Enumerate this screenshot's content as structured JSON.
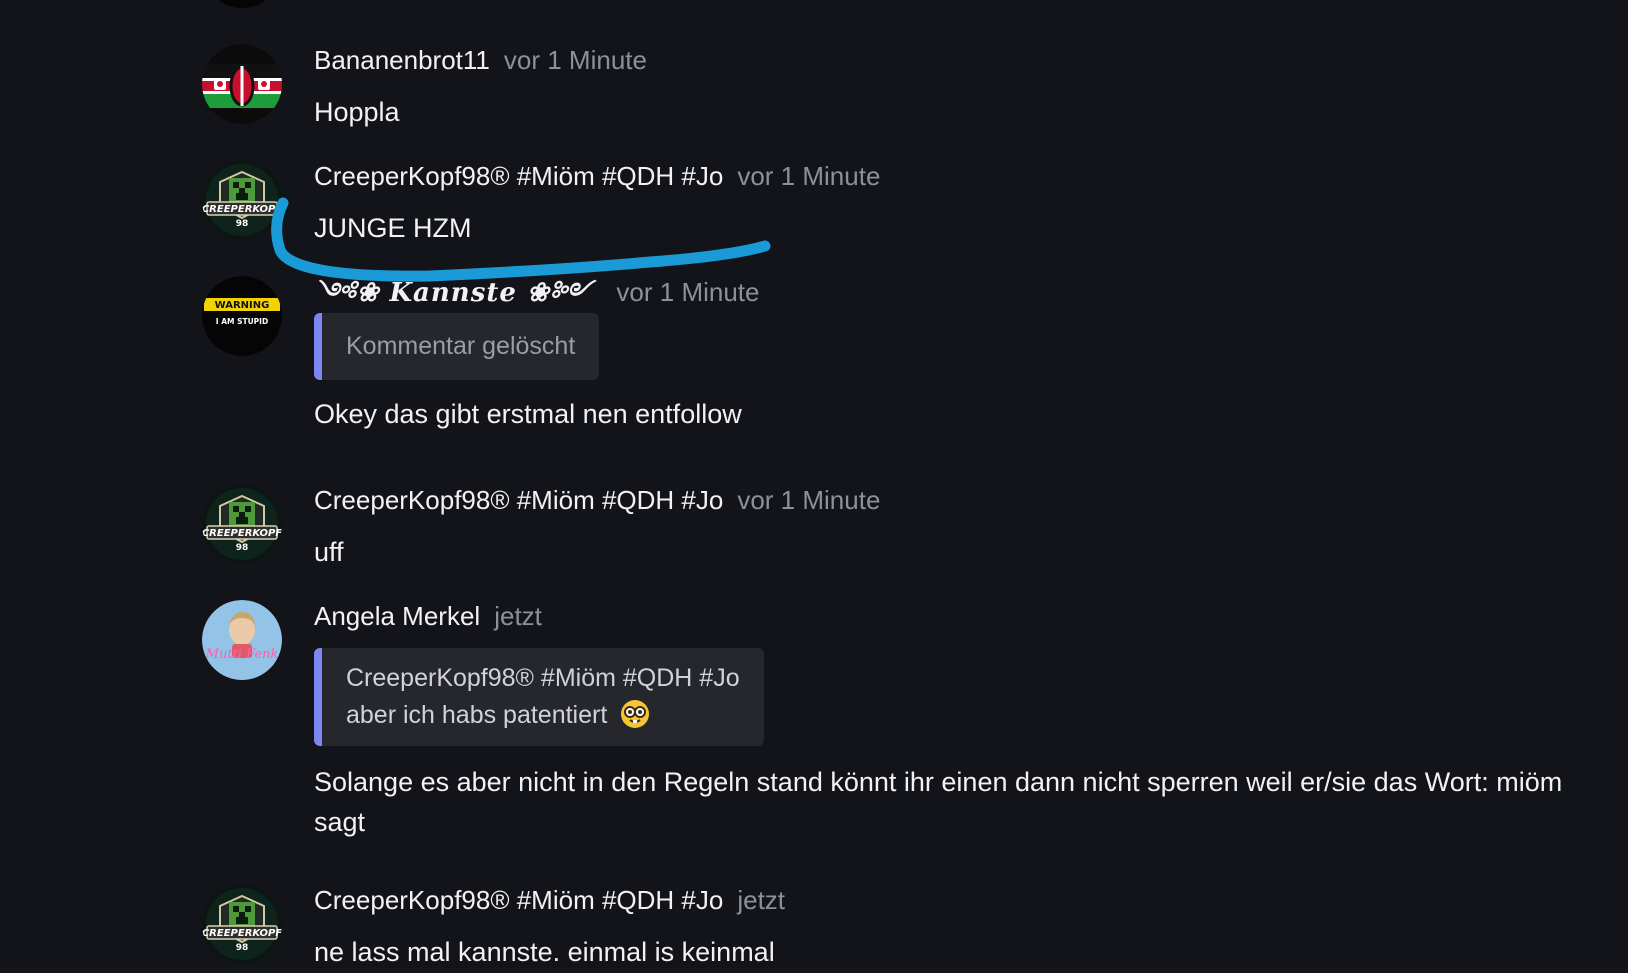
{
  "messages": [
    {
      "username": "Bananenbrot11",
      "timestamp": "vor 1 Minute",
      "text": "Hoppla",
      "avatar_icon": "kenya-flag-shield-avatar"
    },
    {
      "username": "CreeperKopf98® #Miöm #QDH #Jo",
      "timestamp": "vor 1 Minute",
      "text": "JUNGE HZM",
      "avatar_icon": "creeperkopf-badge-avatar",
      "avatar_label": "CREEPERKOPF",
      "avatar_sublabel": "98",
      "annotation_color": "#1a9bd7"
    },
    {
      "username": "Kannste",
      "timestamp": "vor 1 Minute",
      "deleted_notice": "Kommentar gelöscht",
      "text": "Okey das gibt erstmal nen entfollow",
      "avatar_icon": "warning-sign-avatar",
      "avatar_label": "WARNING",
      "avatar_sublabel": "I AM STUPID"
    },
    {
      "username": "CreeperKopf98® #Miöm #QDH #Jo",
      "timestamp": "vor 1 Minute",
      "text": "uff",
      "avatar_icon": "creeperkopf-badge-avatar",
      "avatar_label": "CREEPERKOPF",
      "avatar_sublabel": "98"
    },
    {
      "username": "Angela Merkel",
      "timestamp": "jetzt",
      "quote": {
        "author": "CreeperKopf98® #Miöm #QDH #Jo",
        "text": "aber ich habs patentiert",
        "emoji_icon": "nerd-face-emoji"
      },
      "text": "Solange es aber nicht in den Regeln stand könnt ihr einen dann nicht sperren weil er/sie das Wort: miöm sagt",
      "avatar_icon": "portrait-avatar",
      "avatar_label": "Mutti Fenk"
    },
    {
      "username": "CreeperKopf98® #Miöm #QDH #Jo",
      "timestamp": "jetzt",
      "text": "ne lass mal kannste. einmal is keinmal",
      "avatar_icon": "creeperkopf-badge-avatar",
      "avatar_label": "CREEPERKOPF",
      "avatar_sublabel": "98"
    }
  ],
  "colors": {
    "background": "#131419",
    "quote_accent": "#7d86f2",
    "timestamp": "#8e9097"
  }
}
